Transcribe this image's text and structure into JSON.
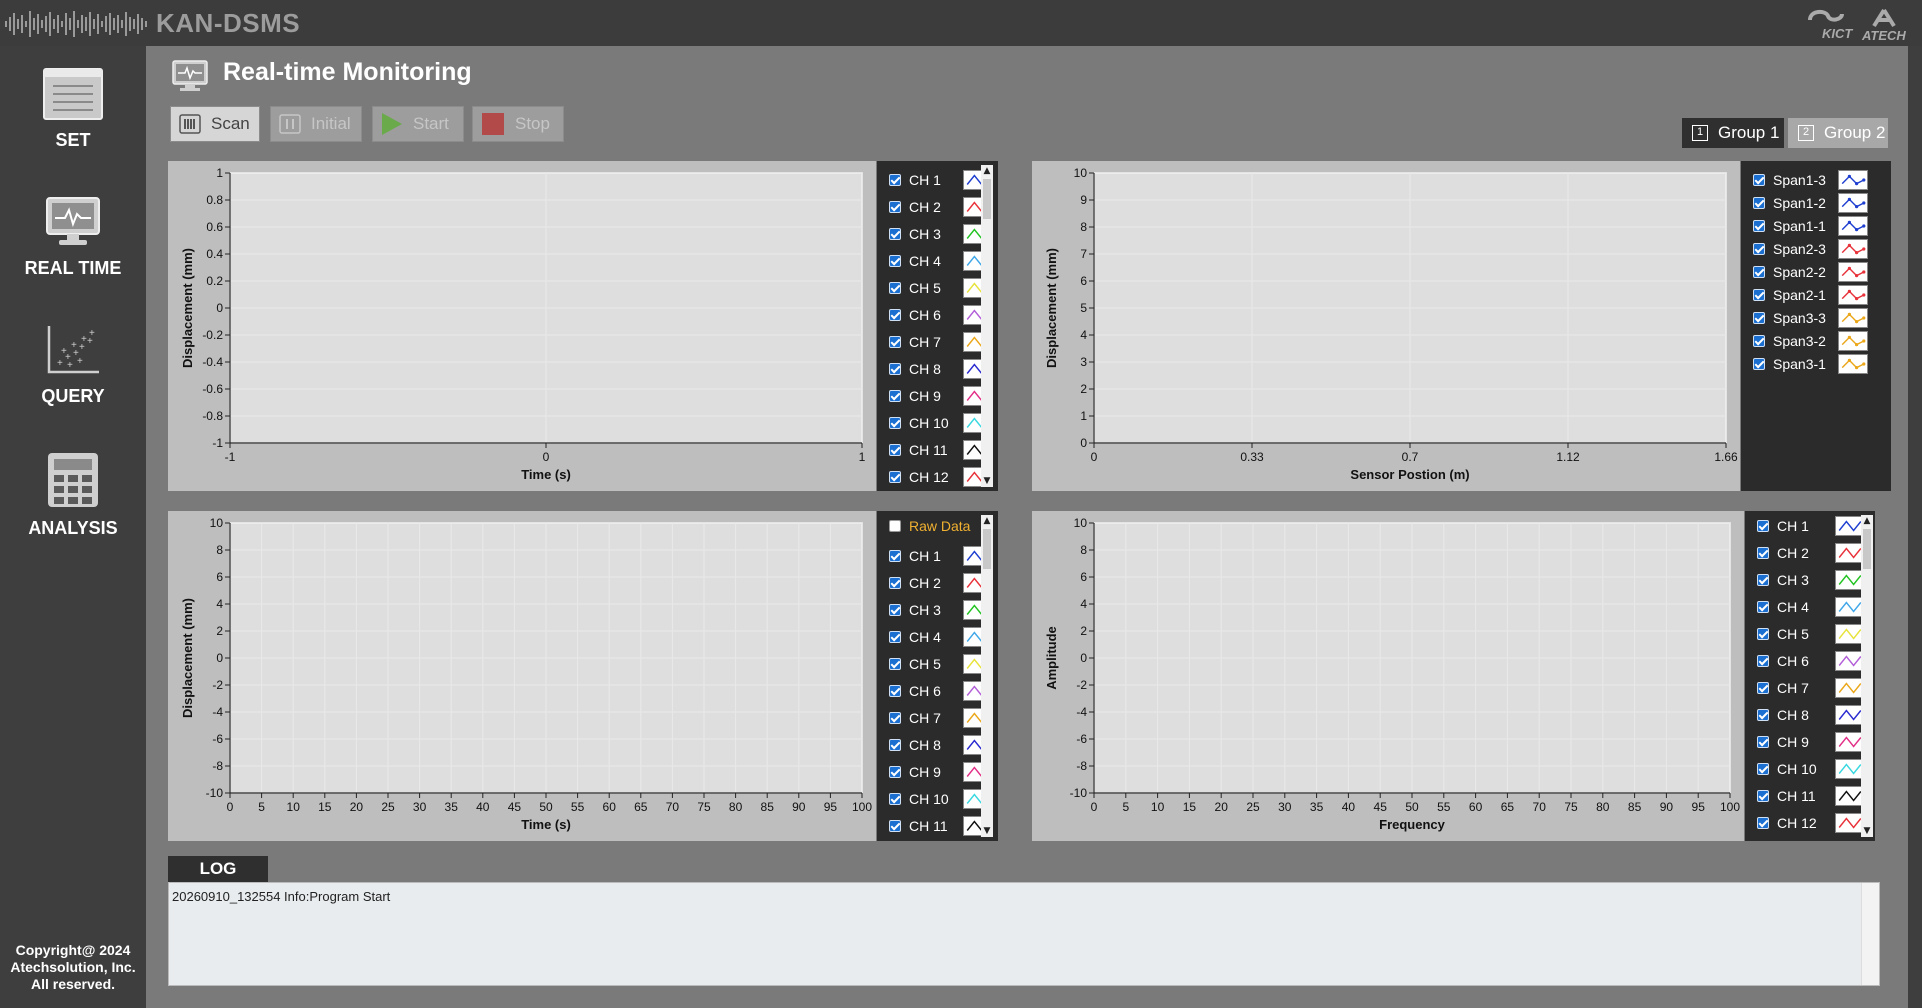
{
  "app": {
    "title": "KAN-DSMS",
    "logo_left": "KICT",
    "logo_right": "ATECH"
  },
  "sidebar": {
    "items": [
      {
        "label": "SET",
        "icon": "list-icon"
      },
      {
        "label": "REAL TIME",
        "icon": "monitor-icon"
      },
      {
        "label": "QUERY",
        "icon": "scatter-icon"
      },
      {
        "label": "ANALYSIS",
        "icon": "calculator-icon"
      }
    ],
    "copyright": [
      "Copyright@ 2024",
      "Atechsolution, Inc.",
      "All reserved."
    ]
  },
  "page": {
    "title": "Real-time Monitoring"
  },
  "toolbar": {
    "scan": "Scan",
    "initial": "Initial",
    "start": "Start",
    "stop": "Stop"
  },
  "groups": {
    "group1": "Group 1",
    "group2": "Group 2",
    "group1_num": "1",
    "group2_num": "2",
    "active": "group1"
  },
  "colors": {
    "ch": [
      "#1f3fd0",
      "#e8323a",
      "#22c322",
      "#40a7e8",
      "#e7e33b",
      "#b25fd8",
      "#eba71a",
      "#2b2bd0",
      "#e23088",
      "#39d8e0",
      "#111111",
      "#e8323a"
    ],
    "span": [
      "#1f3fd0",
      "#1f3fd0",
      "#1f3fd0",
      "#e8323a",
      "#e8323a",
      "#e8323a",
      "#eba71a",
      "#eba71a",
      "#eba71a"
    ]
  },
  "legend1": {
    "items": [
      "CH 1",
      "CH 2",
      "CH 3",
      "CH 4",
      "CH 5",
      "CH 6",
      "CH 7",
      "CH 8",
      "CH 9",
      "CH 10",
      "CH 11",
      "CH 12"
    ]
  },
  "legend2": {
    "items": [
      "Span1-3",
      "Span1-2",
      "Span1-1",
      "Span2-3",
      "Span2-2",
      "Span2-1",
      "Span3-3",
      "Span3-2",
      "Span3-1"
    ]
  },
  "legend3": {
    "raw_label": "Raw Data",
    "raw_checked": false,
    "items": [
      "CH 1",
      "CH 2",
      "CH 3",
      "CH 4",
      "CH 5",
      "CH 6",
      "CH 7",
      "CH 8",
      "CH 9",
      "CH 10",
      "CH 11"
    ]
  },
  "legend4": {
    "items": [
      "CH 1",
      "CH 2",
      "CH 3",
      "CH 4",
      "CH 5",
      "CH 6",
      "CH 7",
      "CH 8",
      "CH 9",
      "CH 10",
      "CH 11",
      "CH 12"
    ]
  },
  "chart_data": [
    {
      "type": "line",
      "xlabel": "Time (s)",
      "ylabel": "Displacement (mm)",
      "xlim": [
        -1,
        1
      ],
      "ylim": [
        -1,
        1
      ],
      "xticks": [
        "-1",
        "0",
        "1"
      ],
      "yticks": [
        "1",
        "0.8",
        "0.6",
        "0.4",
        "0.2",
        "0",
        "-0.2",
        "-0.4",
        "-0.6",
        "-0.8",
        "-1"
      ],
      "series": []
    },
    {
      "type": "line",
      "xlabel": "Sensor Postion (m)",
      "ylabel": "Displacement (mm)",
      "xlim": [
        0,
        1.66
      ],
      "ylim": [
        0,
        10
      ],
      "xticks": [
        "0",
        "0.33",
        "0.7",
        "1.12",
        "1.66"
      ],
      "yticks": [
        "10",
        "9",
        "8",
        "7",
        "6",
        "5",
        "4",
        "3",
        "2",
        "1",
        "0"
      ],
      "series": []
    },
    {
      "type": "line",
      "xlabel": "Time (s)",
      "ylabel": "Displacement (mm)",
      "xlim": [
        0,
        100
      ],
      "ylim": [
        -10,
        10
      ],
      "xticks": [
        "0",
        "5",
        "10",
        "15",
        "20",
        "25",
        "30",
        "35",
        "40",
        "45",
        "50",
        "55",
        "60",
        "65",
        "70",
        "75",
        "80",
        "85",
        "90",
        "95",
        "100"
      ],
      "yticks": [
        "10",
        "8",
        "6",
        "4",
        "2",
        "0",
        "-2",
        "-4",
        "-6",
        "-8",
        "-10"
      ],
      "series": []
    },
    {
      "type": "line",
      "xlabel": "Frequency",
      "ylabel": "Amplitude",
      "xlim": [
        0,
        100
      ],
      "ylim": [
        -10,
        10
      ],
      "xticks": [
        "0",
        "5",
        "10",
        "15",
        "20",
        "25",
        "30",
        "35",
        "40",
        "45",
        "50",
        "55",
        "60",
        "65",
        "70",
        "75",
        "80",
        "85",
        "90",
        "95",
        "100"
      ],
      "yticks": [
        "10",
        "8",
        "6",
        "4",
        "2",
        "0",
        "-2",
        "-4",
        "-6",
        "-8",
        "-10"
      ],
      "series": []
    }
  ],
  "log": {
    "title": "LOG",
    "lines": [
      "20260910_132554 Info:Program Start"
    ]
  }
}
